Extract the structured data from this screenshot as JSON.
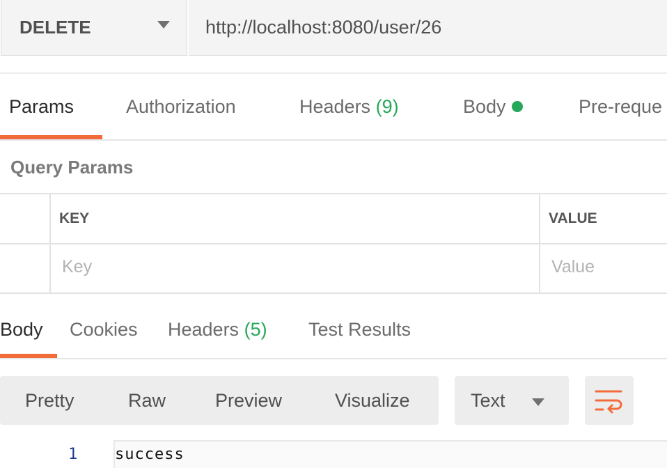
{
  "request": {
    "method": "DELETE",
    "url": "http://localhost:8080/user/26"
  },
  "request_tabs": {
    "params": "Params",
    "authorization": "Authorization",
    "headers_label": "Headers",
    "headers_count": "(9)",
    "body": "Body",
    "pre_request": "Pre-reque"
  },
  "query_params": {
    "title": "Query Params",
    "columns": {
      "key": "KEY",
      "value": "VALUE"
    },
    "placeholders": {
      "key": "Key",
      "value": "Value"
    }
  },
  "response_tabs": {
    "body": "Body",
    "cookies": "Cookies",
    "headers_label": "Headers",
    "headers_count": "(5)",
    "test_results": "Test Results"
  },
  "view_modes": {
    "pretty": "Pretty",
    "raw": "Raw",
    "preview": "Preview",
    "visualize": "Visualize",
    "format": "Text"
  },
  "response_body": {
    "line_number": "1",
    "content": "success"
  },
  "colors": {
    "accent": "#f26b3a",
    "count_green": "#26a85a"
  },
  "icons": {
    "method_dropdown": "chevron-down-icon",
    "format_dropdown": "chevron-down-icon",
    "wrap": "wrap-lines-icon",
    "body_indicator": "dot-icon"
  }
}
